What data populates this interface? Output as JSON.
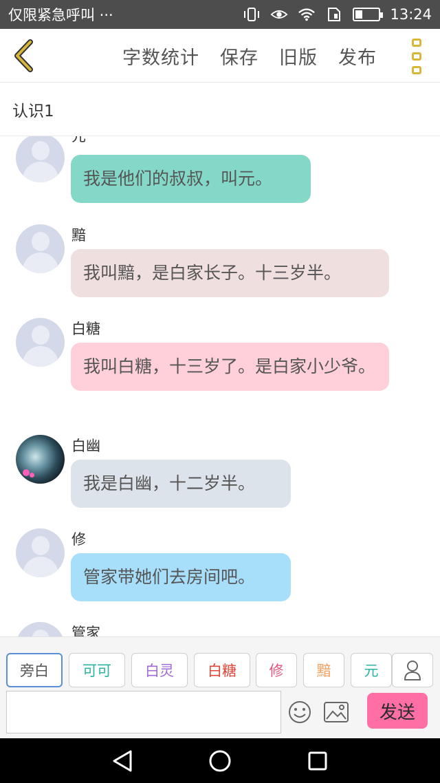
{
  "status_bar": {
    "left_text": "仅限紧急呼叫 ···",
    "time": "13:24",
    "icons": [
      "vibrate-icon",
      "eye-icon",
      "wifi-icon",
      "sim-icon",
      "battery-icon"
    ]
  },
  "toolbar": {
    "word_count_label": "字数统计",
    "save_label": "保存",
    "old_version_label": "旧版",
    "publish_label": "发布",
    "accent_color": "#d7b63a"
  },
  "title": "认识1",
  "messages": [
    {
      "speaker": "元",
      "text": "我是他们的叔叔，叫元。",
      "color": "#84d8c8"
    },
    {
      "speaker": "黯",
      "text": "我叫黯，是白家长子。十三岁半。",
      "color": "#f0dfdf"
    },
    {
      "speaker": "白糖",
      "text": "我叫白糖，十三岁了。是白家小少爷。",
      "color": "#ffcfda"
    },
    {
      "speaker": "白幽",
      "text": "我是白幽，十二岁半。",
      "color": "#dde3ea"
    },
    {
      "speaker": "修",
      "text": "管家带她们去房间吧。",
      "color": "#a7dffb"
    },
    {
      "speaker": "管家",
      "text": "",
      "color": ""
    }
  ],
  "role_chips": [
    {
      "label": "旁白",
      "color": "#555555"
    },
    {
      "label": "可可",
      "color": "#2bb3a3"
    },
    {
      "label": "白灵",
      "color": "#a169d6"
    },
    {
      "label": "白糖",
      "color": "#e0453a"
    },
    {
      "label": "修",
      "color": "#e2557e"
    },
    {
      "label": "黯",
      "color": "#f0a060"
    },
    {
      "label": "元",
      "color": "#2bb3a3"
    }
  ],
  "input": {
    "value": "",
    "placeholder": ""
  },
  "send_label": "发送",
  "send_color": "#ff6fa6"
}
